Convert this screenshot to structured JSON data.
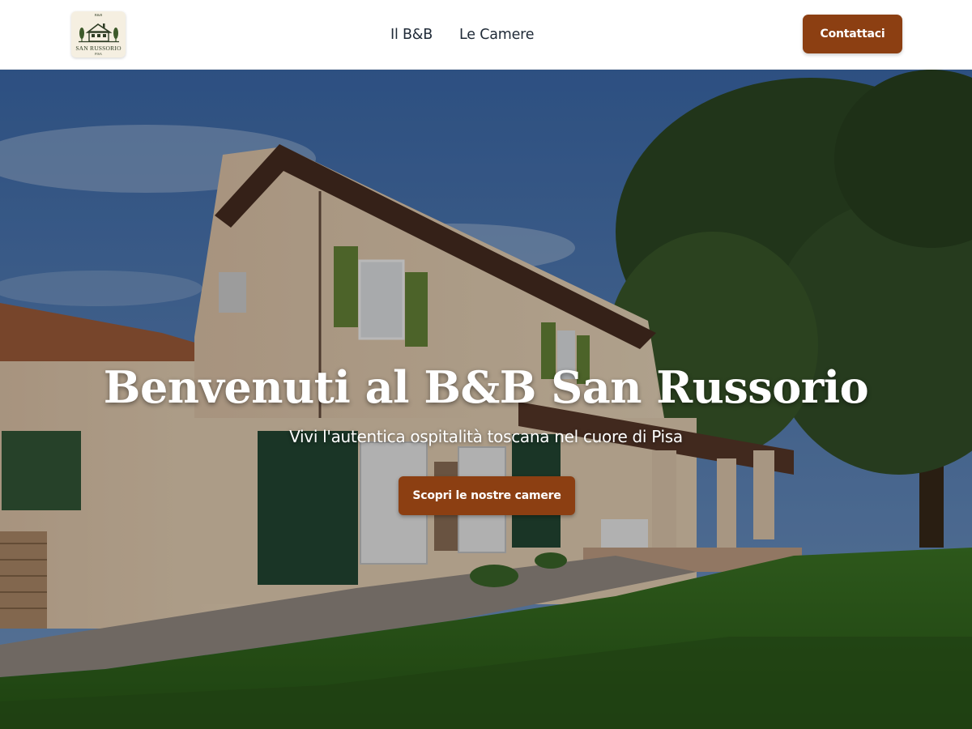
{
  "header": {
    "logo": {
      "icon": "house-with-trees-icon",
      "top_text": "B&B",
      "name": "SAN RUSSORIO",
      "sub_text": "PISA"
    },
    "nav": [
      {
        "label": "Il B&B"
      },
      {
        "label": "Le Camere"
      }
    ],
    "contact_button": "Contattaci"
  },
  "hero": {
    "title": "Benvenuti al B&B San Russorio",
    "subtitle": "Vivi l'autentica ospitalità toscana nel cuore di Pisa",
    "button": "Scopri le nostre camere",
    "image": "villa-with-garden-photo"
  },
  "colors": {
    "accent": "#8c3f12",
    "header_bg": "#ffffff",
    "nav_text": "#1f2a37",
    "hero_text": "#ffffff"
  }
}
